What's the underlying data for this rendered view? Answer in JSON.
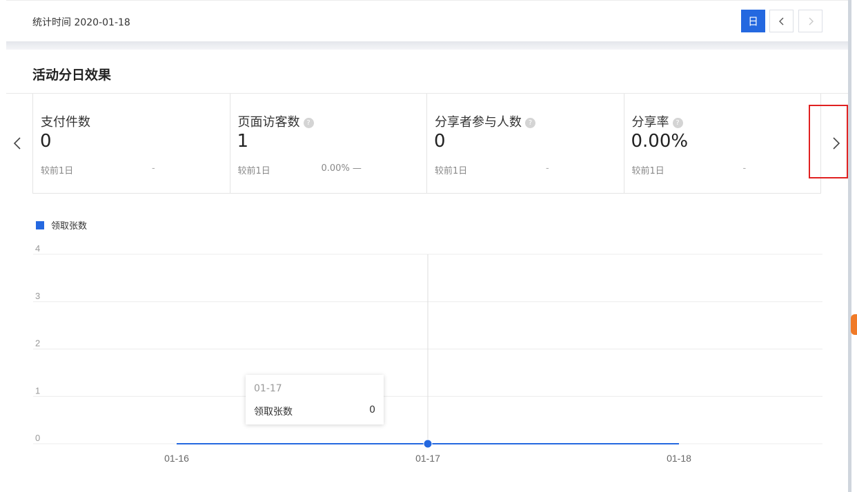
{
  "header": {
    "stat_time": "统计时间 2020-01-18",
    "period_button": "日",
    "prev_icon": "chevron-left-icon",
    "next_icon": "chevron-right-icon"
  },
  "section": {
    "title": "活动分日效果"
  },
  "cards": [
    {
      "label": "支付件数",
      "value": "0",
      "compare": "较前1日",
      "change": "-",
      "has_help": false
    },
    {
      "label": "页面访客数",
      "value": "1",
      "compare": "较前1日",
      "change": "0.00% —",
      "has_help": true
    },
    {
      "label": "分享者参与人数",
      "value": "0",
      "compare": "较前1日",
      "change": "-",
      "has_help": true
    },
    {
      "label": "分享率",
      "value": "0.00%",
      "compare": "较前1日",
      "change": "-",
      "has_help": true
    }
  ],
  "colors": {
    "accent": "#2468e0",
    "highlight_box": "#e02020"
  },
  "chart_data": {
    "type": "line",
    "categories": [
      "01-16",
      "01-17",
      "01-18"
    ],
    "series": [
      {
        "name": "领取张数",
        "values": [
          0,
          0,
          0
        ]
      }
    ],
    "ylim": [
      0,
      4
    ],
    "yticks": [
      "0",
      "1",
      "2",
      "3",
      "4"
    ],
    "legend": "top-left",
    "grid": true
  },
  "tooltip": {
    "title": "01-17",
    "label": "领取张数",
    "value": "0"
  }
}
